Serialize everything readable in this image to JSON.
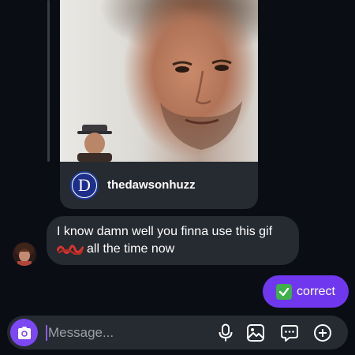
{
  "shared_post": {
    "author": "thedawsonhuzz",
    "author_avatar_letter": "D"
  },
  "incoming": {
    "line1": "I know damn well you finna use this gif",
    "line2": "all the time now"
  },
  "outgoing": {
    "text": "correct",
    "emoji": "white-check-mark"
  },
  "composer": {
    "placeholder": "Message...",
    "icons": [
      "camera-icon",
      "microphone-icon",
      "gallery-icon",
      "sticker-icon",
      "plus-icon"
    ]
  },
  "colors": {
    "background": "#0b0d14",
    "bubble_incoming": "#262a31",
    "bubble_outgoing": "#6f38ee",
    "camera_button": "#7b48f3",
    "check_emoji": "#3fb04a"
  }
}
